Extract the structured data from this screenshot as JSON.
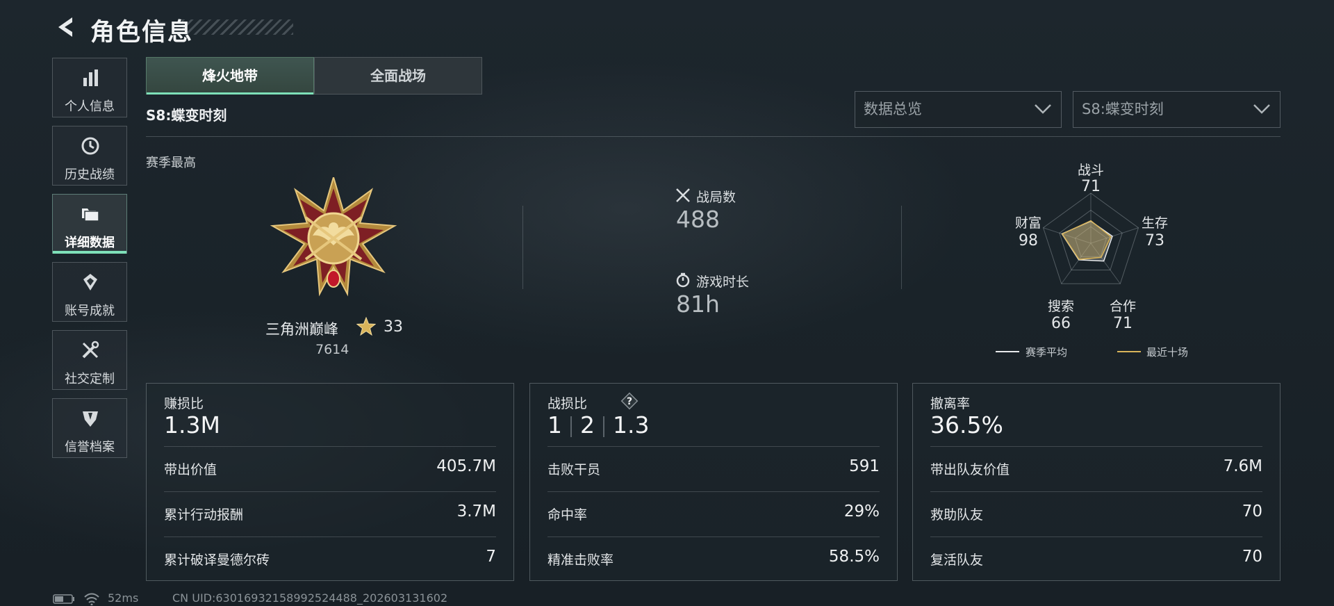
{
  "header": {
    "title": "角色信息"
  },
  "sidebar": {
    "items": [
      {
        "label": "个人信息",
        "icon": "bar-chart-icon"
      },
      {
        "label": "历史战绩",
        "icon": "history-clock-icon"
      },
      {
        "label": "详细数据",
        "icon": "folders-icon",
        "active": true
      },
      {
        "label": "账号成就",
        "icon": "achievement-icon"
      },
      {
        "label": "社交定制",
        "icon": "tools-icon"
      },
      {
        "label": "信誉档案",
        "icon": "reputation-shield-icon"
      }
    ]
  },
  "tabs": [
    {
      "label": "烽火地带",
      "active": true
    },
    {
      "label": "全面战场",
      "active": false
    }
  ],
  "season": {
    "label": "S8:蝶变时刻"
  },
  "filters": {
    "view_select": "数据总览",
    "season_select": "S8:蝶变时刻"
  },
  "summary": {
    "section_label": "赛季最高",
    "rank_name": "三角洲巅峰",
    "rank_stars": "33",
    "rank_score": "7614",
    "matches_label": "战局数",
    "matches_value": "488",
    "playtime_label": "游戏时长",
    "playtime_value": "81h"
  },
  "radar": {
    "axes": [
      {
        "label": "战斗",
        "value": "71"
      },
      {
        "label": "生存",
        "value": "73"
      },
      {
        "label": "合作",
        "value": "71"
      },
      {
        "label": "搜索",
        "value": "66"
      },
      {
        "label": "财富",
        "value": "98"
      }
    ],
    "season_avg_fraction": [
      0.71,
      0.73,
      0.71,
      0.66,
      0.98
    ],
    "recent_fraction": [
      0.45,
      0.42,
      0.35,
      0.4,
      0.6
    ],
    "legend_avg": "赛季平均",
    "legend_recent": "最近十场",
    "color_avg": "#e8eaec",
    "color_recent": "#d9b45a"
  },
  "cards": {
    "profit": {
      "title": "赚损比",
      "value": "1.3M",
      "rows": [
        {
          "label": "带出价值",
          "value": "405.7M"
        },
        {
          "label": "累计行动报酬",
          "value": "3.7M"
        },
        {
          "label": "累计破译曼德尔砖",
          "value": "7"
        }
      ]
    },
    "kd": {
      "title": "战损比",
      "help": "?",
      "values": [
        "1",
        "2",
        "1.3"
      ],
      "rows": [
        {
          "label": "击败干员",
          "value": "591"
        },
        {
          "label": "命中率",
          "value": "29%"
        },
        {
          "label": "精准击败率",
          "value": "58.5%"
        }
      ]
    },
    "extract": {
      "title": "撤离率",
      "value": "36.5%",
      "rows": [
        {
          "label": "带出队友价值",
          "value": "7.6M"
        },
        {
          "label": "救助队友",
          "value": "70"
        },
        {
          "label": "复活队友",
          "value": "70"
        }
      ]
    }
  },
  "footer": {
    "ping": "52ms",
    "uid": "CN UID:6301693215899252448​8_202603131602"
  },
  "colors": {
    "accent": "#7ee0b8"
  }
}
